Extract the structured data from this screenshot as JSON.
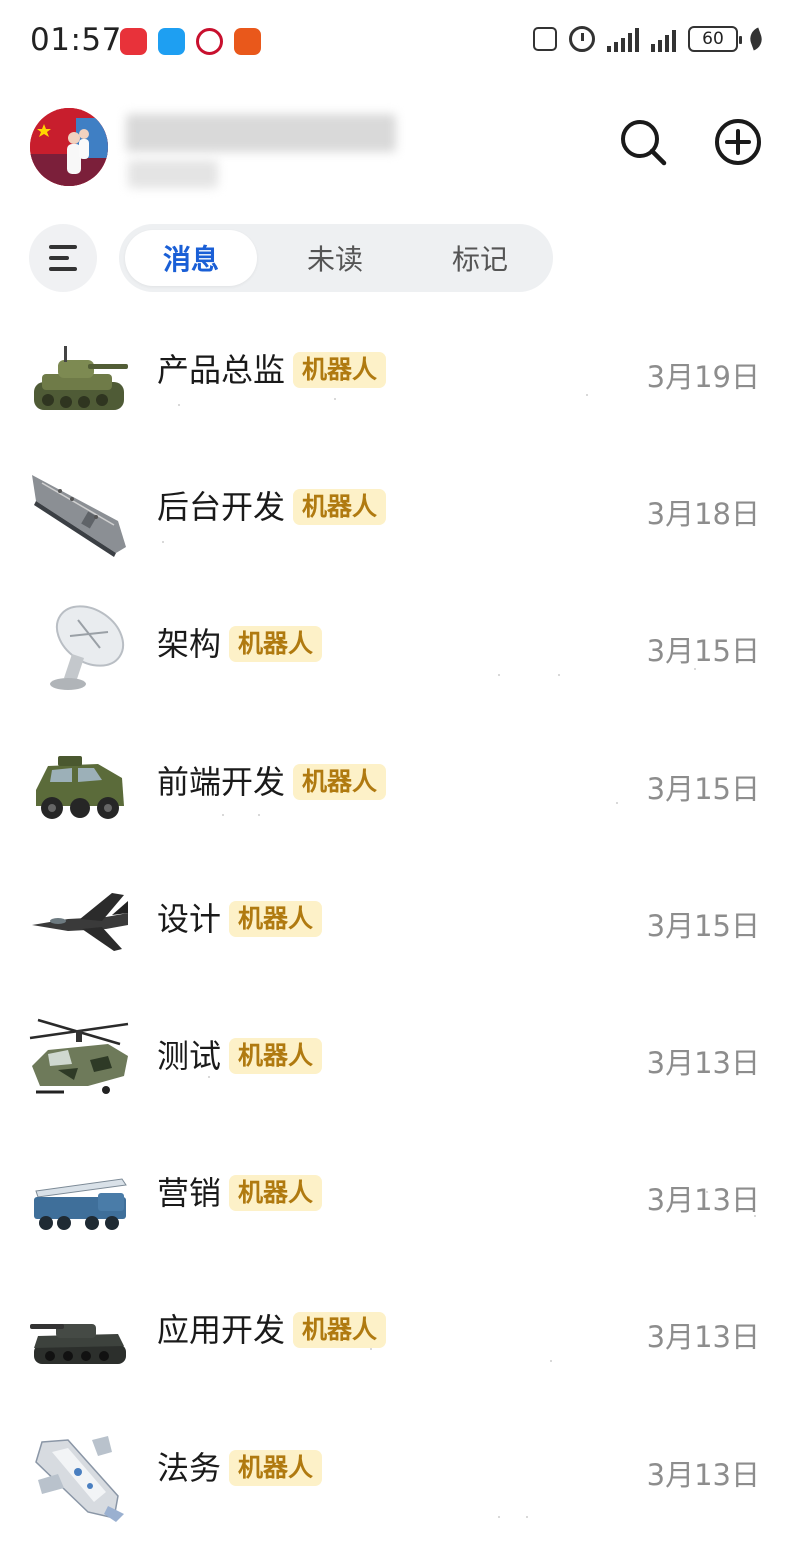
{
  "status_bar": {
    "time": "01:57",
    "battery": "60"
  },
  "header": {
    "search_icon": "search-icon",
    "add_icon": "plus-circle-icon"
  },
  "filters": {
    "tabs": [
      {
        "label": "消息",
        "active": true
      },
      {
        "label": "未读",
        "active": false
      },
      {
        "label": "标记",
        "active": false
      }
    ]
  },
  "chats": [
    {
      "name": "产品总监",
      "badge": "机器人",
      "date": "3月19日",
      "avatar_icon": "tank-icon"
    },
    {
      "name": "后台开发",
      "badge": "机器人",
      "date": "3月18日",
      "avatar_icon": "aircraft-carrier-icon"
    },
    {
      "name": "架构",
      "badge": "机器人",
      "date": "3月15日",
      "avatar_icon": "satellite-dish-icon"
    },
    {
      "name": "前端开发",
      "badge": "机器人",
      "date": "3月15日",
      "avatar_icon": "armored-vehicle-icon"
    },
    {
      "name": "设计",
      "badge": "机器人",
      "date": "3月15日",
      "avatar_icon": "fighter-jet-icon"
    },
    {
      "name": "测试",
      "badge": "机器人",
      "date": "3月13日",
      "avatar_icon": "helicopter-icon"
    },
    {
      "name": "营销",
      "badge": "机器人",
      "date": "3月13日",
      "avatar_icon": "missile-launcher-icon"
    },
    {
      "name": "应用开发",
      "badge": "机器人",
      "date": "3月13日",
      "avatar_icon": "tank-icon"
    },
    {
      "name": "法务",
      "badge": "机器人",
      "date": "3月13日",
      "avatar_icon": "spaceship-icon"
    }
  ],
  "colors": {
    "accent": "#1a5fd6",
    "badge_bg": "#fdf1c8",
    "badge_text": "#b07a10",
    "date": "#8d8d8d"
  }
}
